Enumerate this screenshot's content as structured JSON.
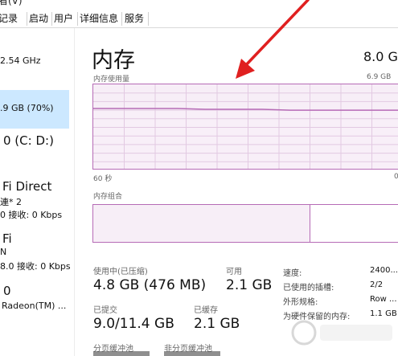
{
  "menu_partial": "看(V)",
  "tabs": [
    {
      "label": "记录"
    },
    {
      "label": "启动"
    },
    {
      "label": "用户"
    },
    {
      "label": "详细信息"
    },
    {
      "label": "服务"
    }
  ],
  "sidebar": {
    "cpu_speed": "2.54 GHz",
    "memory_usage": ".9 GB (70%)",
    "disk": "0 (C: D:)",
    "wifi_direct_title": "Fi Direct",
    "wifi_direct_sub": "連* 2",
    "wifi_direct_rate": "0 接收: 0 Kbps",
    "wifi_title": "Fi",
    "wifi_sub": "N",
    "wifi_rate": "8.0 接收: 0 Kbps",
    "gpu_title": "0",
    "gpu_sub": "Radeon(TM) ..."
  },
  "main": {
    "title": "内存",
    "total": "8.0 GB",
    "usage_label": "内存使用量",
    "usage_max": "6.9 GB",
    "axis_left": "60 秒",
    "axis_right": "0",
    "composition_label": "内存组合",
    "in_use_label": "使用中(已压缩)",
    "in_use_value": "4.8 GB (476 MB)",
    "available_label": "可用",
    "available_value": "2.1 GB",
    "committed_label": "已提交",
    "committed_value": "9.0/11.4 GB",
    "cached_label": "已缓存",
    "cached_value": "2.1 GB",
    "paged_pool_label": "分页缓冲池",
    "nonpaged_pool_label": "非分页缓冲池",
    "details": [
      {
        "label": "速度:",
        "value": "2400..."
      },
      {
        "label": "已使用的插槽:",
        "value": "2/2"
      },
      {
        "label": "外形规格:",
        "value": "Row ..."
      },
      {
        "label": "为硬件保留的内存:",
        "value": "1.1 GB"
      }
    ]
  },
  "chart_data": {
    "type": "area",
    "title": "内存使用量",
    "x_range_labels": [
      "60 秒",
      "0"
    ],
    "y_max_label": "6.9 GB",
    "usage_fraction": [
      0.72,
      0.72,
      0.72,
      0.72,
      0.71,
      0.71,
      0.71,
      0.7,
      0.7,
      0.7,
      0.7,
      0.7
    ],
    "composition": {
      "in_use_fraction": 0.7,
      "cached_fraction": 0.3
    }
  },
  "colors": {
    "accent": "#b66bb6",
    "chart_fill": "#f7eef7",
    "selected": "#cce8ff",
    "arrow": "#e02020"
  }
}
